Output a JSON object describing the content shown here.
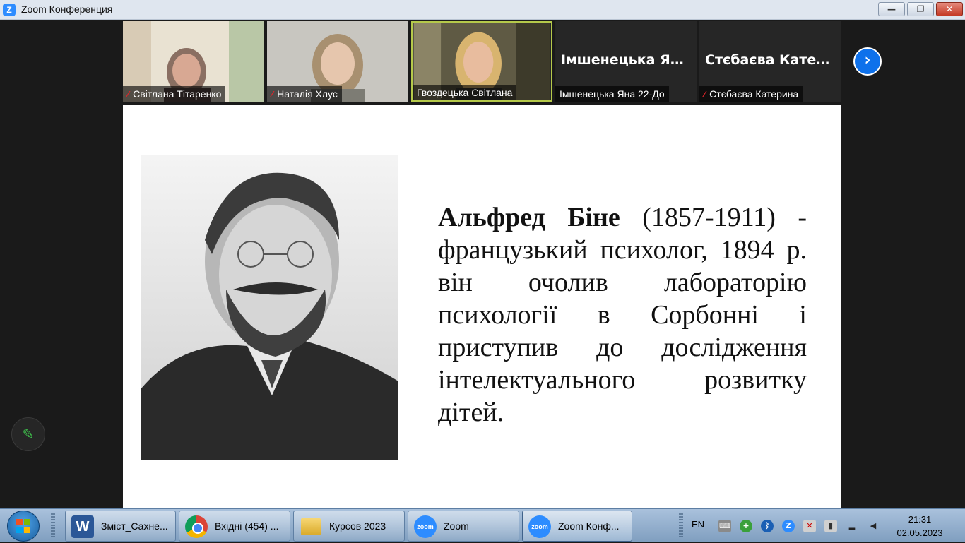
{
  "window": {
    "app_icon": "Z",
    "title": "Zoom Конференция",
    "minimize_icon": "—",
    "maximize_icon": "❐",
    "close_icon": "✕"
  },
  "participants": [
    {
      "name": "Світлана Тітаренко",
      "muted": true,
      "video": true
    },
    {
      "name": "Наталія Хлус",
      "muted": true,
      "video": true
    },
    {
      "name": "Гвоздецька Світлана",
      "muted": false,
      "video": true,
      "active_speaker": true
    },
    {
      "name": "Імшенецька Яна 22-До",
      "display_name": "Імшенецька Ян...",
      "muted": false,
      "video": false
    },
    {
      "name": "Стєбаєва Катерина",
      "display_name": "Стєбаєва Катер...",
      "muted": true,
      "video": false
    }
  ],
  "mute_icon": "🎙",
  "next_page_icon": "›",
  "slide": {
    "name_bold": "Альфред Біне",
    "body": " (1857-1911) - французький психолог, 1894 р. він очолив лабораторію психології в Сорбонні і приступив до дослідження інтелектуального розвитку дітей."
  },
  "annotate_icon": "✎",
  "taskbar": {
    "items": [
      {
        "label": "Зміст_Сахне...",
        "icon": "word-icon",
        "glyph": "W"
      },
      {
        "label": "Вхідні (454) ...",
        "icon": "chrome-icon",
        "glyph": ""
      },
      {
        "label": "Курсов 2023",
        "icon": "folder-icon",
        "glyph": ""
      },
      {
        "label": "Zoom",
        "icon": "zoom-icon",
        "glyph": "zoom"
      },
      {
        "label": "Zoom Конф...",
        "icon": "zoom-icon",
        "glyph": "zoom"
      }
    ],
    "language": "EN",
    "time": "21:31",
    "date": "02.05.2023"
  }
}
